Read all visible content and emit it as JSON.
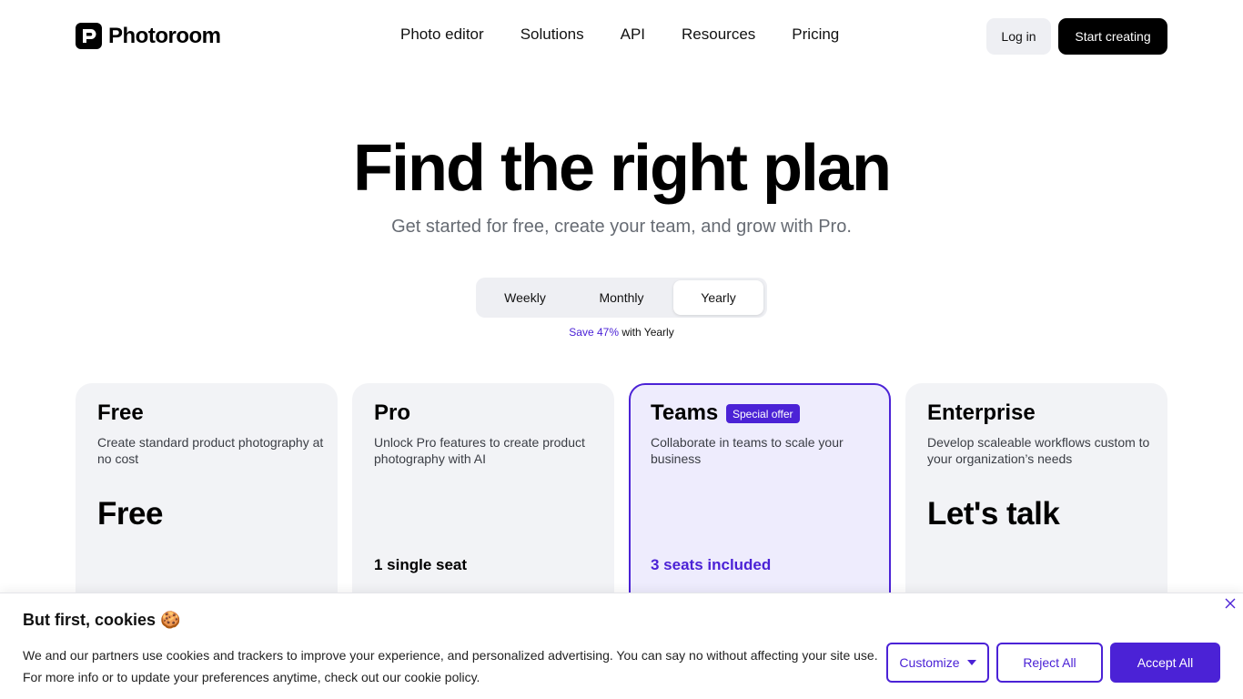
{
  "header": {
    "logo_text": "Photoroom",
    "nav": [
      "Photo editor",
      "Solutions",
      "API",
      "Resources",
      "Pricing"
    ],
    "login_label": "Log in",
    "start_label": "Start creating"
  },
  "hero": {
    "title": "Find the right plan",
    "subtitle": "Get started for free, create your team, and grow with Pro."
  },
  "billing": {
    "options": [
      "Weekly",
      "Monthly",
      "Yearly"
    ],
    "selected": "Yearly",
    "save_prefix": "Save 47%",
    "save_suffix": " with Yearly"
  },
  "plans": [
    {
      "name": "Free",
      "description": "Create standard product photography at no cost",
      "price": "Free",
      "seats": ""
    },
    {
      "name": "Pro",
      "description": "Unlock Pro features to create product photography with AI",
      "price": "",
      "seats": "1 single seat"
    },
    {
      "name": "Teams",
      "badge": "Special offer",
      "description": "Collaborate in teams to scale your business",
      "price": "",
      "seats": "3 seats included"
    },
    {
      "name": "Enterprise",
      "description": "Develop scaleable workflows custom to your organization’s needs",
      "price": "Let's talk",
      "seats": ""
    }
  ],
  "cookie": {
    "title": "But first, cookies 🍪",
    "line1": "We and our partners use cookies and trackers to improve your experience, and personalized advertising. You can say no without affecting your site use.",
    "line2": "For more info or to update your preferences anytime, check out our cookie policy.",
    "customize_label": "Customize",
    "reject_label": "Reject All",
    "accept_label": "Accept All"
  },
  "colors": {
    "accent": "#4b22d6",
    "card_bg": "#f2f3f6",
    "teams_bg": "#eeecfd"
  },
  "icons": [
    "photoroom-logo-icon",
    "close-icon",
    "caret-down-icon"
  ]
}
